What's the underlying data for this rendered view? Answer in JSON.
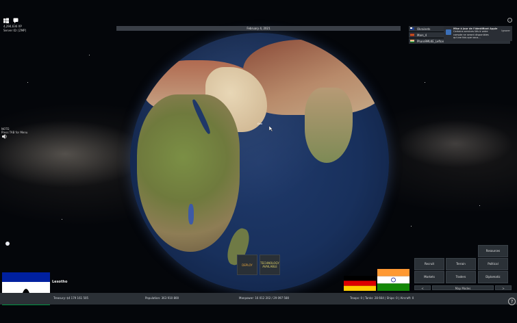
{
  "top_left": {
    "line1": "4,294,636 XP",
    "line2": "Server ID: [ZMP]"
  },
  "date": "February 4, 2021",
  "players": [
    {
      "name": "Okrainets",
      "flag_colors": [
        "#1f3d8a",
        "#ffffff"
      ]
    },
    {
      "name": "Mars_4",
      "flag_colors": [
        "#d47a1f",
        "#a01c1c"
      ]
    },
    {
      "name": "Pharo9MLKE_Lefton",
      "flag_colors": [
        "#ff9933",
        "#138808"
      ]
    }
  ],
  "notification": {
    "title": "Mise à jour de l'identifiant Apple",
    "body": "Certains services liés à votre compte ne seront disponibles qu'une fois que vous...",
    "dismiss": "Ignorer"
  },
  "note": {
    "line1": "NOTE:",
    "line2": "Press TAB for Menu"
  },
  "globe_labels": {
    "city": "Goa"
  },
  "center_buttons": {
    "deploy": "DEPLOY",
    "technology": "TECHNOLOGY AVAILABLE"
  },
  "country": {
    "name": "Lesotho"
  },
  "stats": {
    "treasury": "Treasury:  $4 179 161 505",
    "population": "Population:  363 910 800",
    "manpower": "Manpower:  16 012 202 / 29 097 580",
    "troops": "Troops: 0  |  Tanks: 28 664  |  Ships: 0  |  Aircraft: 0"
  },
  "right_menu": {
    "resources": "Resources",
    "row1": [
      "Recruit",
      "Terrain",
      "Political"
    ],
    "row2": [
      "Markets",
      "Traders",
      "Diplomatic"
    ],
    "nav_left": "<",
    "nav_center": "Map Modes",
    "nav_right": ">"
  },
  "help": "?"
}
